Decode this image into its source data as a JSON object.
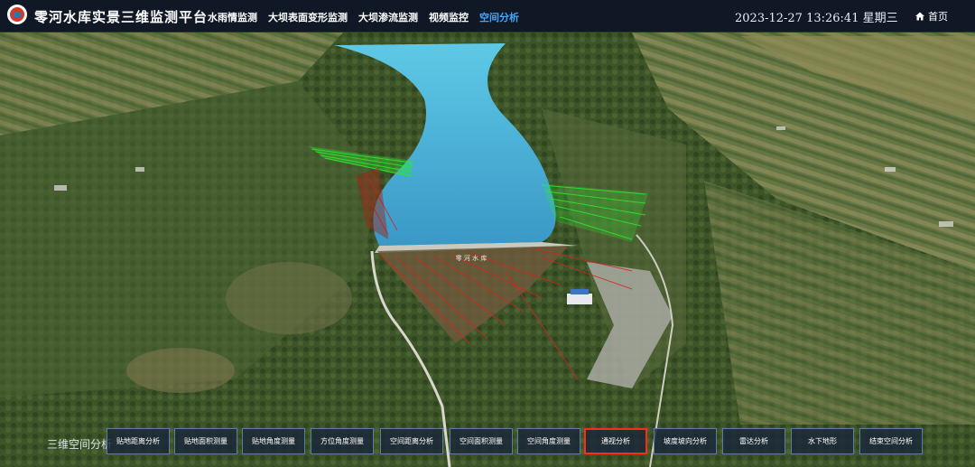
{
  "app": {
    "title": "零河水库实景三维监测平台",
    "datetime": "2023-12-27  13:26:41 星期三",
    "home_label": "首页"
  },
  "nav": {
    "items": [
      "水雨情监测",
      "大坝表面变形监测",
      "大坝渗流监测",
      "视频监控",
      "空间分析"
    ],
    "active": "空间分析"
  },
  "scene": {
    "dam_label": "零 河 水 库"
  },
  "toolbar": {
    "label": "三维空间分析",
    "buttons": [
      "贴地距离分析",
      "贴地面积测量",
      "贴地角度测量",
      "方位角度测量",
      "空间距离分析",
      "空间面积测量",
      "空间角度测量",
      "通视分析",
      "坡度坡向分析",
      "雷达分析",
      "水下地形",
      "结束空间分析"
    ],
    "selected": "通视分析"
  },
  "colors": {
    "header_bg": "#101826",
    "nav_active": "#3fa9ff",
    "selected_border": "#ff2a1a",
    "water": "#4ab3d4",
    "visible_line": "#2ee82e",
    "hidden_line": "#d8231c"
  }
}
